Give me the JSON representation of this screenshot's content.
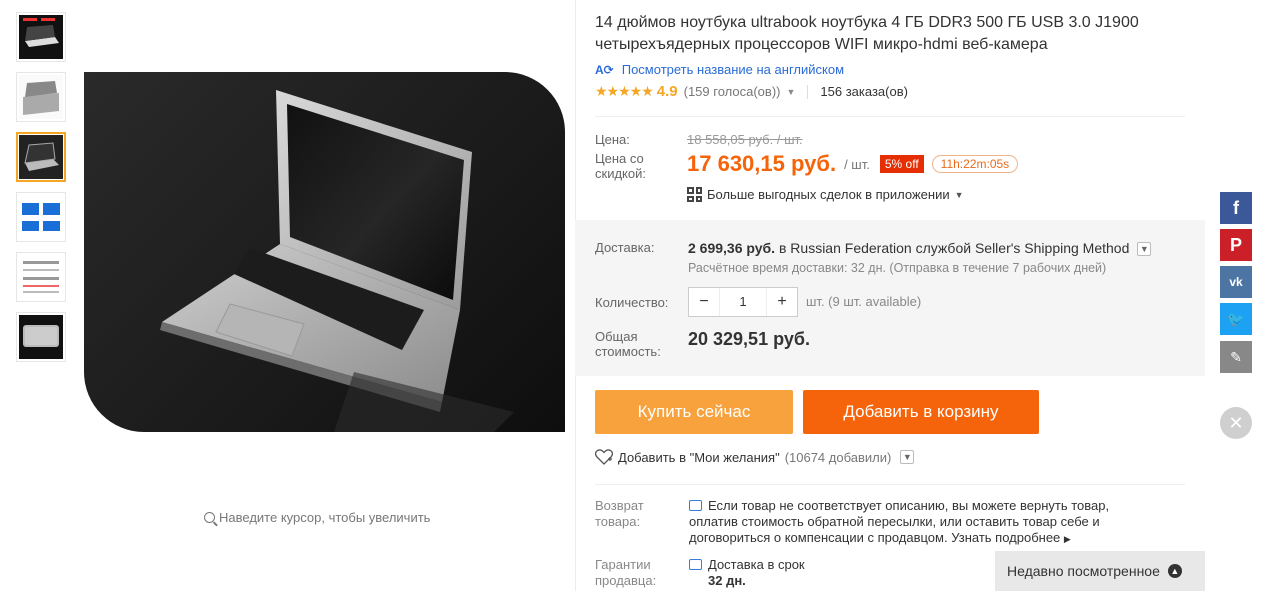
{
  "product": {
    "title": "14 дюймов ноутбука ultrabook ноутбука 4 ГБ DDR3 500 ГБ USB 3.0 J1900 четырехъядерных процессоров WIFI микро-hdmi веб-камера",
    "translate_link": "Посмотреть название на английском",
    "translate_icon": "translate-icon",
    "stars": "★★★★★",
    "rating": "4.9",
    "votes": "(159 голоса(ов))",
    "orders": "156 заказа(ов)"
  },
  "price": {
    "label": "Цена:",
    "old_price": "18 558,05 руб. / шт.",
    "discount_label": "Цена со скидкой:",
    "new_price": "17 630,15 руб.",
    "per_unit": "/ шт.",
    "discount_badge": "5% off",
    "timer": "11h:22m:05s",
    "app_deals": "Больше выгодных сделок в приложении"
  },
  "shipping": {
    "label": "Доставка:",
    "cost": "2 699,36 руб.",
    "destination_text": "в Russian Federation службой Seller's Shipping Method",
    "eta": "Расчётное время доставки: 32 дн. (Отправка в течение 7 рабочих дней)",
    "quantity_label": "Количество:",
    "quantity_value": "1",
    "quantity_unit": "шт. (9 шт. available)",
    "total_label": "Общая стоимость:",
    "total_value": "20 329,51 руб."
  },
  "buttons": {
    "buy_now": "Купить сейчас",
    "add_to_cart": "Добавить в корзину"
  },
  "wishlist": {
    "label": "Добавить в \"Мои желания\"",
    "count": "(10674 добавили)"
  },
  "guarantee": {
    "return_label": "Возврат товара:",
    "return_text": "Если товар не соответствует описанию, вы можете вернуть товар, оплатив стоимость обратной пересылки, или оставить товар себе и договориться о компенсации с продавцом.",
    "learn_more": "Узнать подробнее",
    "seller_label": "Гарантии продавца:",
    "delivery_label": "Доставка в срок",
    "delivery_days": "32 дн."
  },
  "gallery": {
    "zoom_hint": "Наведите курсор, чтобы увеличить",
    "thumb_count": 6,
    "active_thumb": 3
  },
  "sidebar": {
    "recent_label": "Недавно посмотренное"
  },
  "colors": {
    "accent_orange": "#f5640a",
    "buy_orange": "#f8a23e",
    "link_blue": "#2a6bd8",
    "star_gold": "#f5a623",
    "discount_red": "#e62e04"
  }
}
